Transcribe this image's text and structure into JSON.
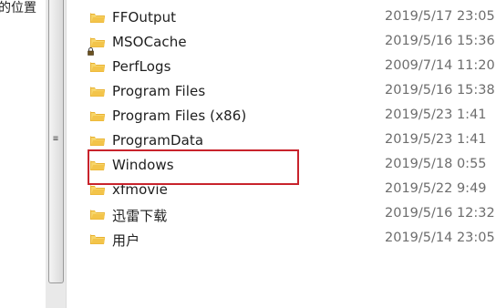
{
  "nav": {
    "label": "的位置"
  },
  "files": [
    {
      "name": "FFOutput",
      "date": "2019/5/17 23:05",
      "locked": false
    },
    {
      "name": "MSOCache",
      "date": "2019/5/16 15:36",
      "locked": true
    },
    {
      "name": "PerfLogs",
      "date": "2009/7/14 11:20",
      "locked": false
    },
    {
      "name": "Program Files",
      "date": "2019/5/16 15:38",
      "locked": false
    },
    {
      "name": "Program Files (x86)",
      "date": "2019/5/23 1:41",
      "locked": false
    },
    {
      "name": "ProgramData",
      "date": "2019/5/23 1:41",
      "locked": false
    },
    {
      "name": "Windows",
      "date": "2019/5/18 0:55",
      "locked": false
    },
    {
      "name": "xfmovie",
      "date": "2019/5/22 9:49",
      "locked": false
    },
    {
      "name": "迅雷下载",
      "date": "2019/5/16 12:32",
      "locked": false
    },
    {
      "name": "用户",
      "date": "2019/5/14 23:05",
      "locked": false
    }
  ],
  "highlight": {
    "target": "Windows",
    "color": "#c8232c"
  },
  "icons": {
    "folder": "folder-icon",
    "lock": "lock-icon"
  }
}
